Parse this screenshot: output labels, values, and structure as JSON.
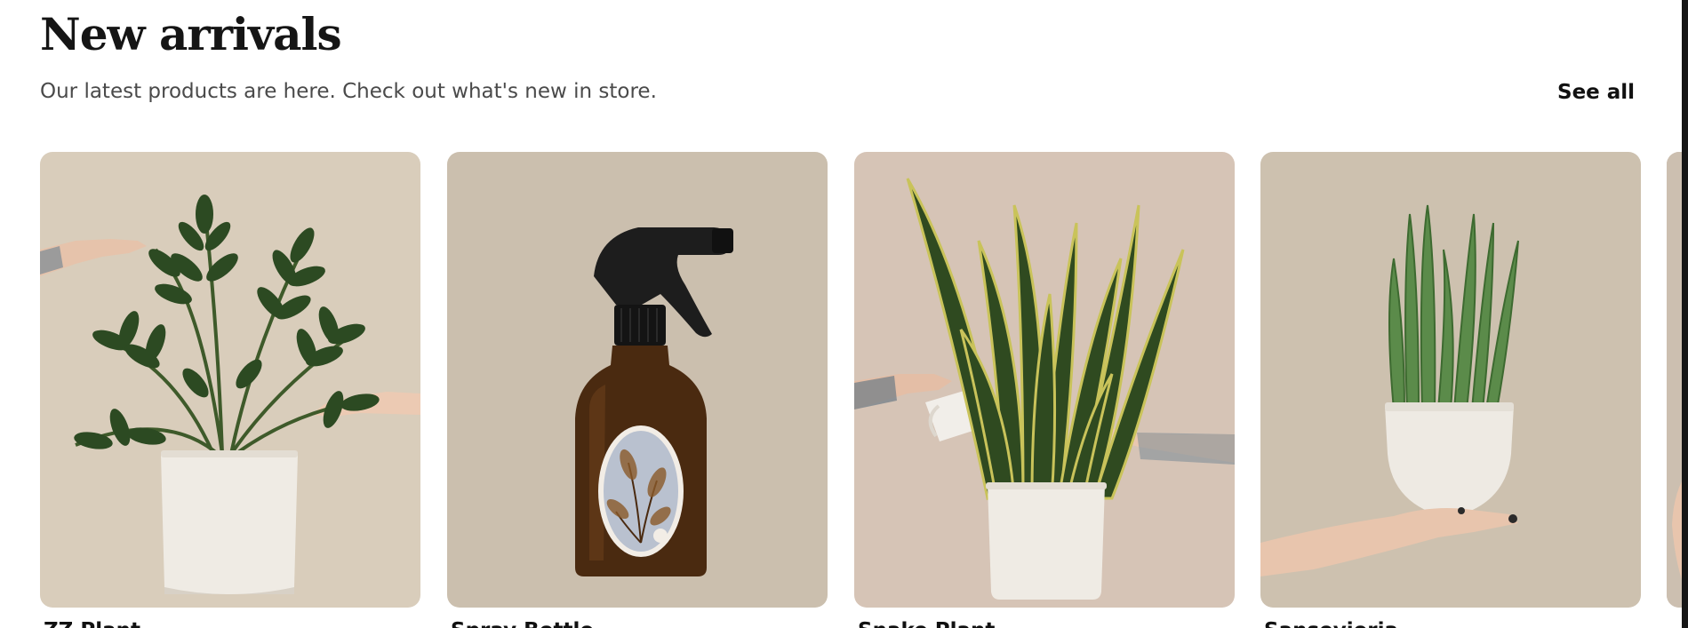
{
  "section": {
    "title": "New arrivals",
    "subtitle": "Our latest products are here. Check out what's new in store.",
    "see_all_label": "See all"
  },
  "products": [
    {
      "name": "ZZ Plant",
      "image_alt": "ZZ plant in white pot",
      "bg": "#d9cdbb"
    },
    {
      "name": "Spray Bottle",
      "image_alt": "Amber spray bottle with black trigger",
      "bg": "#cbbfae"
    },
    {
      "name": "Snake Plant",
      "image_alt": "Snake plant in white pot being watered",
      "bg": "#d6c4b6"
    },
    {
      "name": "Sansevieria",
      "image_alt": "Cylindrical sansevieria held in hand",
      "bg": "#cdc1af"
    }
  ],
  "colors": {
    "title": "#151515",
    "subtitle": "#4a4a4a",
    "leaf_dark": "#24401d",
    "leaf_mid": "#3a6a2a",
    "pot_white": "#efebe4",
    "amber": "#4a2a10",
    "skin": "#e8c5ad"
  }
}
